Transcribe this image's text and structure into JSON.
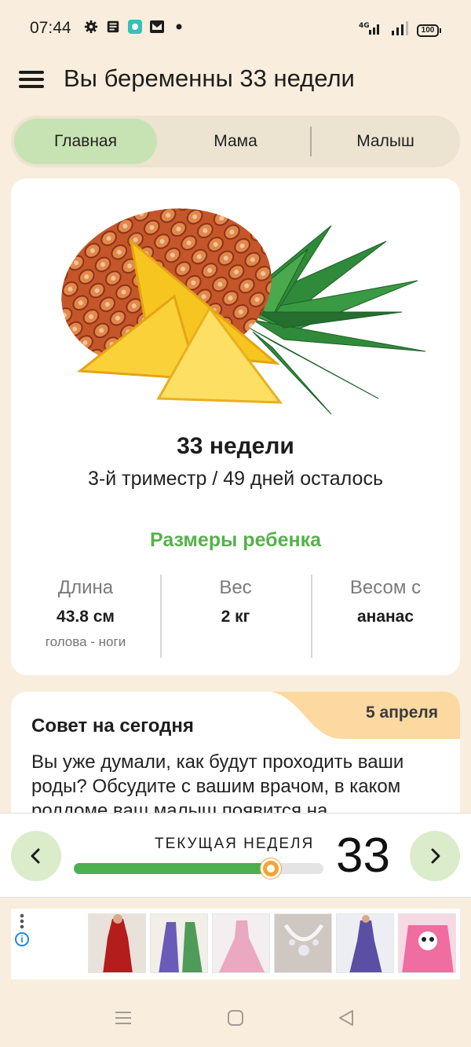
{
  "status": {
    "time": "07:44",
    "battery": "100"
  },
  "header": {
    "title": "Вы беременны 33 недели"
  },
  "tabs": [
    {
      "label": "Главная",
      "active": true
    },
    {
      "label": "Мама",
      "active": false
    },
    {
      "label": "Малыш",
      "active": false
    }
  ],
  "week_card": {
    "title": "33 недели",
    "subtitle": "3-й триместр / 49 дней осталось",
    "sizes_title": "Размеры ребенка",
    "stats": [
      {
        "label": "Длина",
        "value": "43.8 см",
        "note": "голова - ноги"
      },
      {
        "label": "Вес",
        "value": "2 кг",
        "note": ""
      },
      {
        "label": "Весом с",
        "value": "ананас",
        "note": ""
      }
    ]
  },
  "tip": {
    "date": "5 апреля",
    "title": "Совет на сегодня",
    "text": "Вы уже думали, как будут проходить ваши роды? Обсудите с вашим врачом, в каком роддоме ваш малыш появится на"
  },
  "week_selector": {
    "label": "ТЕКУЩАЯ НЕДЕЛЯ",
    "week": "33",
    "progress_fraction": 0.79
  },
  "colors": {
    "background": "#f9eedd",
    "accent_green": "#56b14a",
    "active_tab": "#c8e3b3",
    "progress": "#4caf50",
    "knob": "#f8a334",
    "tip_date_bg": "#fbd9a0"
  },
  "icons": {
    "menu": "hamburger-menu-icon",
    "prev": "chevron-left-icon",
    "next": "chevron-right-icon"
  }
}
